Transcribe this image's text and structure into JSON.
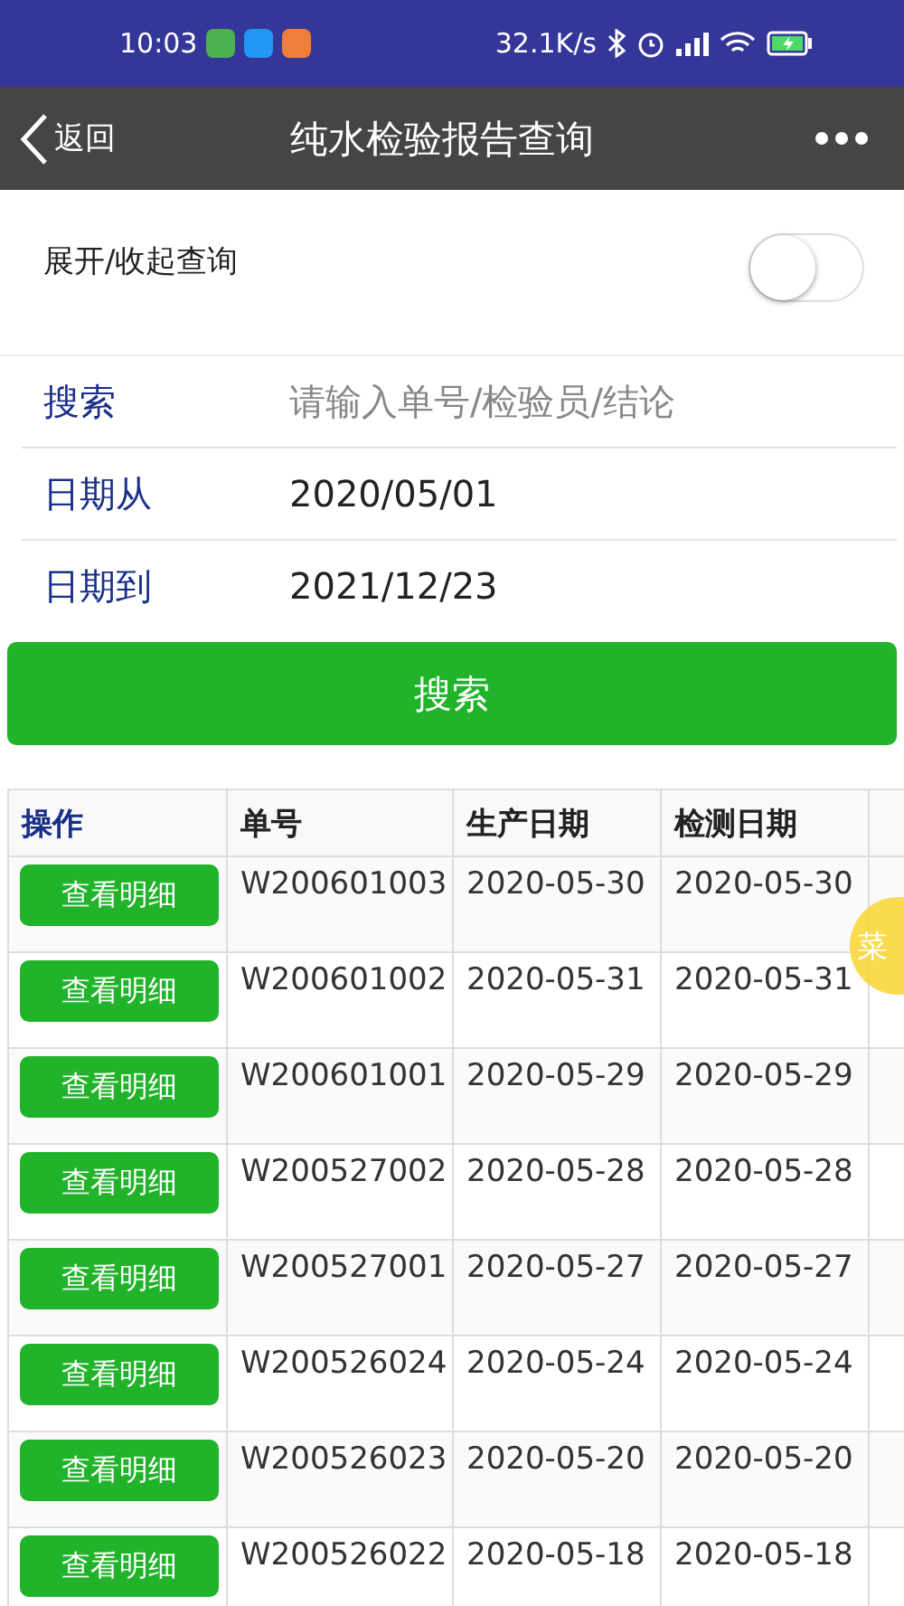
{
  "status_bar": {
    "time": "10:03",
    "speed": "32.1K/s"
  },
  "nav": {
    "back": "返回",
    "title": "纯水检验报告查询"
  },
  "toggle": {
    "label": "展开/收起查询",
    "on": false
  },
  "form": [
    {
      "label": "搜索",
      "placeholder": "请输入单号/检验员/结论"
    },
    {
      "label": "日期从",
      "value": "2020/05/01"
    },
    {
      "label": "日期到",
      "value": "2021/12/23"
    }
  ],
  "search_button": "搜索",
  "table": {
    "columns": [
      "操作",
      "单号",
      "生产日期",
      "检测日期"
    ],
    "rows": [
      {
        "action": "查看明细",
        "number": "W200601003",
        "produced": "2020-05-30",
        "tested": "2020-05-30"
      },
      {
        "action": "查看明细",
        "number": "W200601002",
        "produced": "2020-05-31",
        "tested": "2020-05-31"
      },
      {
        "action": "查看明细",
        "number": "W200601001",
        "produced": "2020-05-29",
        "tested": "2020-05-29"
      },
      {
        "action": "查看明细",
        "number": "W200527002",
        "produced": "2020-05-28",
        "tested": "2020-05-28"
      },
      {
        "action": "查看明细",
        "number": "W200527001",
        "produced": "2020-05-27",
        "tested": "2020-05-27"
      },
      {
        "action": "查看明细",
        "number": "W200526024",
        "produced": "2020-05-24",
        "tested": "2020-05-24"
      },
      {
        "action": "查看明细",
        "number": "W200526023",
        "produced": "2020-05-20",
        "tested": "2020-05-20"
      },
      {
        "action": "查看明细",
        "number": "W200526022",
        "produced": "2020-05-18",
        "tested": "2020-05-18"
      }
    ]
  },
  "floating_button": "菜"
}
